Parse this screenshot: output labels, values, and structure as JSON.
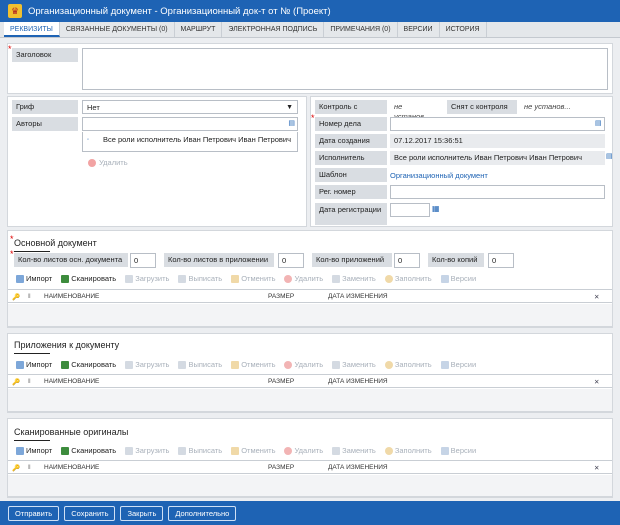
{
  "window": {
    "title": "Организационный документ - Организационный док-т от № (Проект)"
  },
  "tabs": [
    {
      "label": "Реквизиты"
    },
    {
      "label": "Связанные документы (0)"
    },
    {
      "label": "Маршрут"
    },
    {
      "label": "Электронная подпись"
    },
    {
      "label": "Примечания (0)"
    },
    {
      "label": "Версии"
    },
    {
      "label": "История"
    }
  ],
  "header_panel": {
    "title_label": "Заголовок",
    "title_value": ""
  },
  "left": {
    "grif_label": "Гриф",
    "grif_value": "Нет",
    "authors_label": "Авторы",
    "author_entry": "Все роли исполнитель Иван Петрович Иван Петрович",
    "delete_label": "Удалить"
  },
  "right": {
    "control_label": "Контроль с",
    "control_value": "не установ...",
    "removed_label": "Снят с контроля",
    "removed_value": "не установ...",
    "case_label": "Номер дела",
    "case_value": "",
    "created_label": "Дата создания",
    "created_value": "07.12.2017 15:36:51",
    "executor_label": "Исполнитель",
    "executor_value": "Все роли исполнитель Иван Петрович Иван Петрович",
    "template_label": "Шаблон",
    "template_value": "Организационный документ",
    "reg_label": "Рег. номер",
    "reg_value": "",
    "regdate_label": "Дата регистрации",
    "regdate_value": ""
  },
  "main_doc": {
    "title": "Основной документ",
    "sheets_main_label": "Кол-во листов осн. документа",
    "sheets_main": "0",
    "sheets_app_label": "Кол-во листов в приложении",
    "sheets_app": "0",
    "apps_label": "Кол-во приложений",
    "apps": "0",
    "copies_label": "Кол-во копий",
    "copies": "0"
  },
  "toolbar": {
    "import": "Импорт",
    "scan": "Сканировать",
    "upload": "Загрузить",
    "checkout": "Выписать",
    "cancel": "Отменить",
    "delete": "Удалить",
    "replace": "Заменить",
    "fill": "Заполнить",
    "versions": "Версии"
  },
  "grid": {
    "col_name": "НАИМЕНОВАНИЕ",
    "col_size": "РАЗМЕР",
    "col_date": "ДАТА ИЗМЕНЕНИЯ"
  },
  "sections": {
    "attachments": "Приложения к документу",
    "scanned": "Сканированные оригиналы"
  },
  "footer": {
    "send": "Отправить",
    "save": "Сохранить",
    "close": "Закрыть",
    "more": "Дополнительно"
  }
}
